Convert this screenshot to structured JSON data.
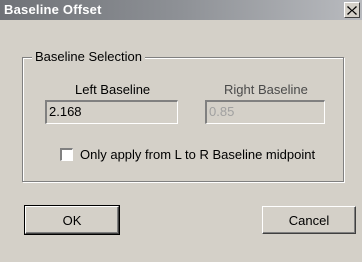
{
  "window": {
    "title": "Baseline Offset",
    "close_symbol": "close-icon"
  },
  "group": {
    "legend": "Baseline Selection",
    "left_label": "Left Baseline",
    "right_label": "Right Baseline",
    "left_value": "2.168",
    "right_value": "0.85",
    "checkbox_label": "Only apply from L to R Baseline midpoint",
    "checkbox_checked": false
  },
  "buttons": {
    "ok_label": "OK",
    "cancel_label": "Cancel"
  },
  "colors": {
    "face": "#d4d0c8",
    "title_start": "#6f7277",
    "title_end": "#b9bbbf",
    "disabled_text": "#a0a0a0"
  }
}
